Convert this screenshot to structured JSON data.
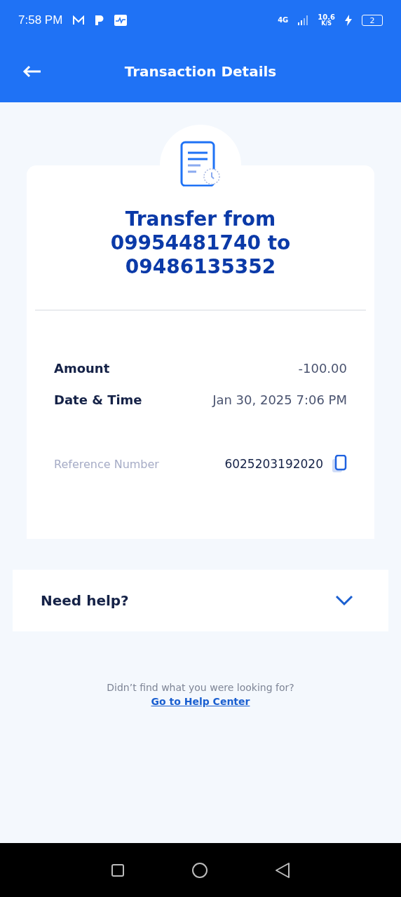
{
  "status_bar": {
    "time": "7:58 PM",
    "network": "4G",
    "speed": "10.6",
    "speed_unit": "K/S",
    "battery": "2"
  },
  "header": {
    "title": "Transaction Details"
  },
  "receipt": {
    "title": "Transfer from 09954481740 to 09486135352",
    "details": [
      {
        "label": "Amount",
        "value": "-100.00"
      },
      {
        "label": "Date & Time",
        "value": "Jan 30, 2025 7:06 PM"
      }
    ],
    "reference": {
      "label": "Reference Number",
      "value": "6025203192020"
    }
  },
  "help": {
    "title": "Need help?",
    "expanded": false
  },
  "footer": {
    "text": "Didn’t find what you were looking for?",
    "link": "Go to Help Center"
  }
}
